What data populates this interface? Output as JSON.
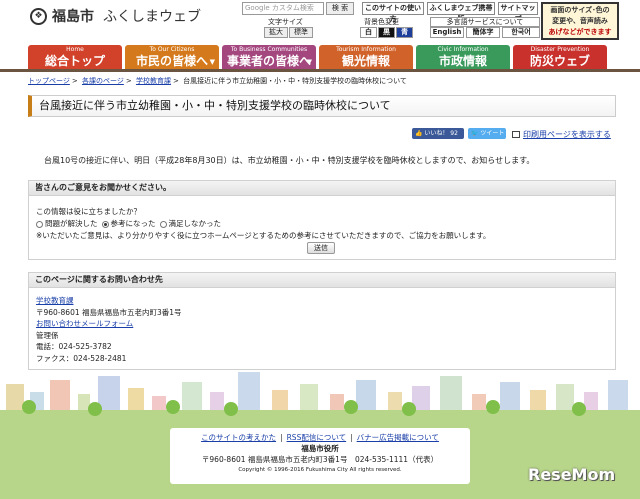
{
  "header": {
    "city": "福島市",
    "site_name": "ふくしまウェブ",
    "search_placeholder": "Google カスタム検索",
    "search_button": "検 索",
    "tools": [
      "このサイトの使い方",
      "ふくしまウェブ携帯版",
      "サイトマップ"
    ],
    "text_size_label": "文字サイズ",
    "text_size_buttons": [
      "拡大",
      "標準"
    ],
    "bg_label": "背景色変更",
    "bg_buttons": [
      "白",
      "黒",
      "青"
    ],
    "multilingual_label": "多言語サービスについて",
    "languages": [
      "English",
      "簡体字",
      "한국어"
    ],
    "voice_banner": [
      "画面のサイズ･色の",
      "変更や、音声読み",
      "あげなどができます"
    ]
  },
  "nav": [
    {
      "en": "Home",
      "ja": "総合トップ",
      "color": "#d2412a"
    },
    {
      "en": "To Our Citizens",
      "ja": "市民の皆様へ",
      "color": "#d57a1c"
    },
    {
      "en": "To Business Communities",
      "ja": "事業者の皆様へ",
      "color": "#a4477f"
    },
    {
      "en": "Tourism Information",
      "ja": "観光情報",
      "color": "#d0622a"
    },
    {
      "en": "Civic Information",
      "ja": "市政情報",
      "color": "#3a9a5c"
    },
    {
      "en": "Disaster Prevention",
      "ja": "防災ウェブ",
      "color": "#c8312c"
    }
  ],
  "breadcrumb": [
    "トップページ",
    "各課のページ",
    "学校教育課",
    "台風接近に伴う市立幼稚園・小・中・特別支援学校の臨時休校について"
  ],
  "page": {
    "title": "台風接近に伴う市立幼稚園・小・中・特別支援学校の臨時休校について",
    "like_label": "いいね！ 92",
    "tweet_label": "ツイート",
    "print_label": "印刷用ページを表示する",
    "body": "台風10号の接近に伴い、明日（平成28年8月30日）は、市立幼稚園・小・中・特別支援学校を臨時休校としますので、お知らせします。"
  },
  "survey": {
    "heading": "皆さんのご意見をお聞かせください。",
    "question": "この情報は役に立ちましたか？",
    "options": [
      "問題が解決した",
      "参考になった",
      "満足しなかった"
    ],
    "selected_index": 1,
    "note": "※いただいたご意見は、より分かりやすく役に立つホームページとするための参考にさせていただきますので、ご協力をお願いします。",
    "submit": "送信"
  },
  "contact": {
    "heading": "このページに関するお問い合わせ先",
    "dept": "学校教育課",
    "address": "〒960-8601 福島県福島市五老内町3番1号",
    "form_link": "お問い合わせメールフォーム",
    "section": "管理係",
    "phone": "電話：024-525-3782",
    "fax": "ファクス：024-528-2481"
  },
  "footer": {
    "links": [
      "このサイトの考えかた",
      "RSS配信について",
      "バナー広告掲載について"
    ],
    "org": "福島市役所",
    "address": "〒960-8601 福島県福島市五老内町3番1号　024-535-1111（代表）",
    "copyright": "Copyright © 1996-2016 Fukushima City All rights reserved."
  },
  "watermark": "ReseMom"
}
